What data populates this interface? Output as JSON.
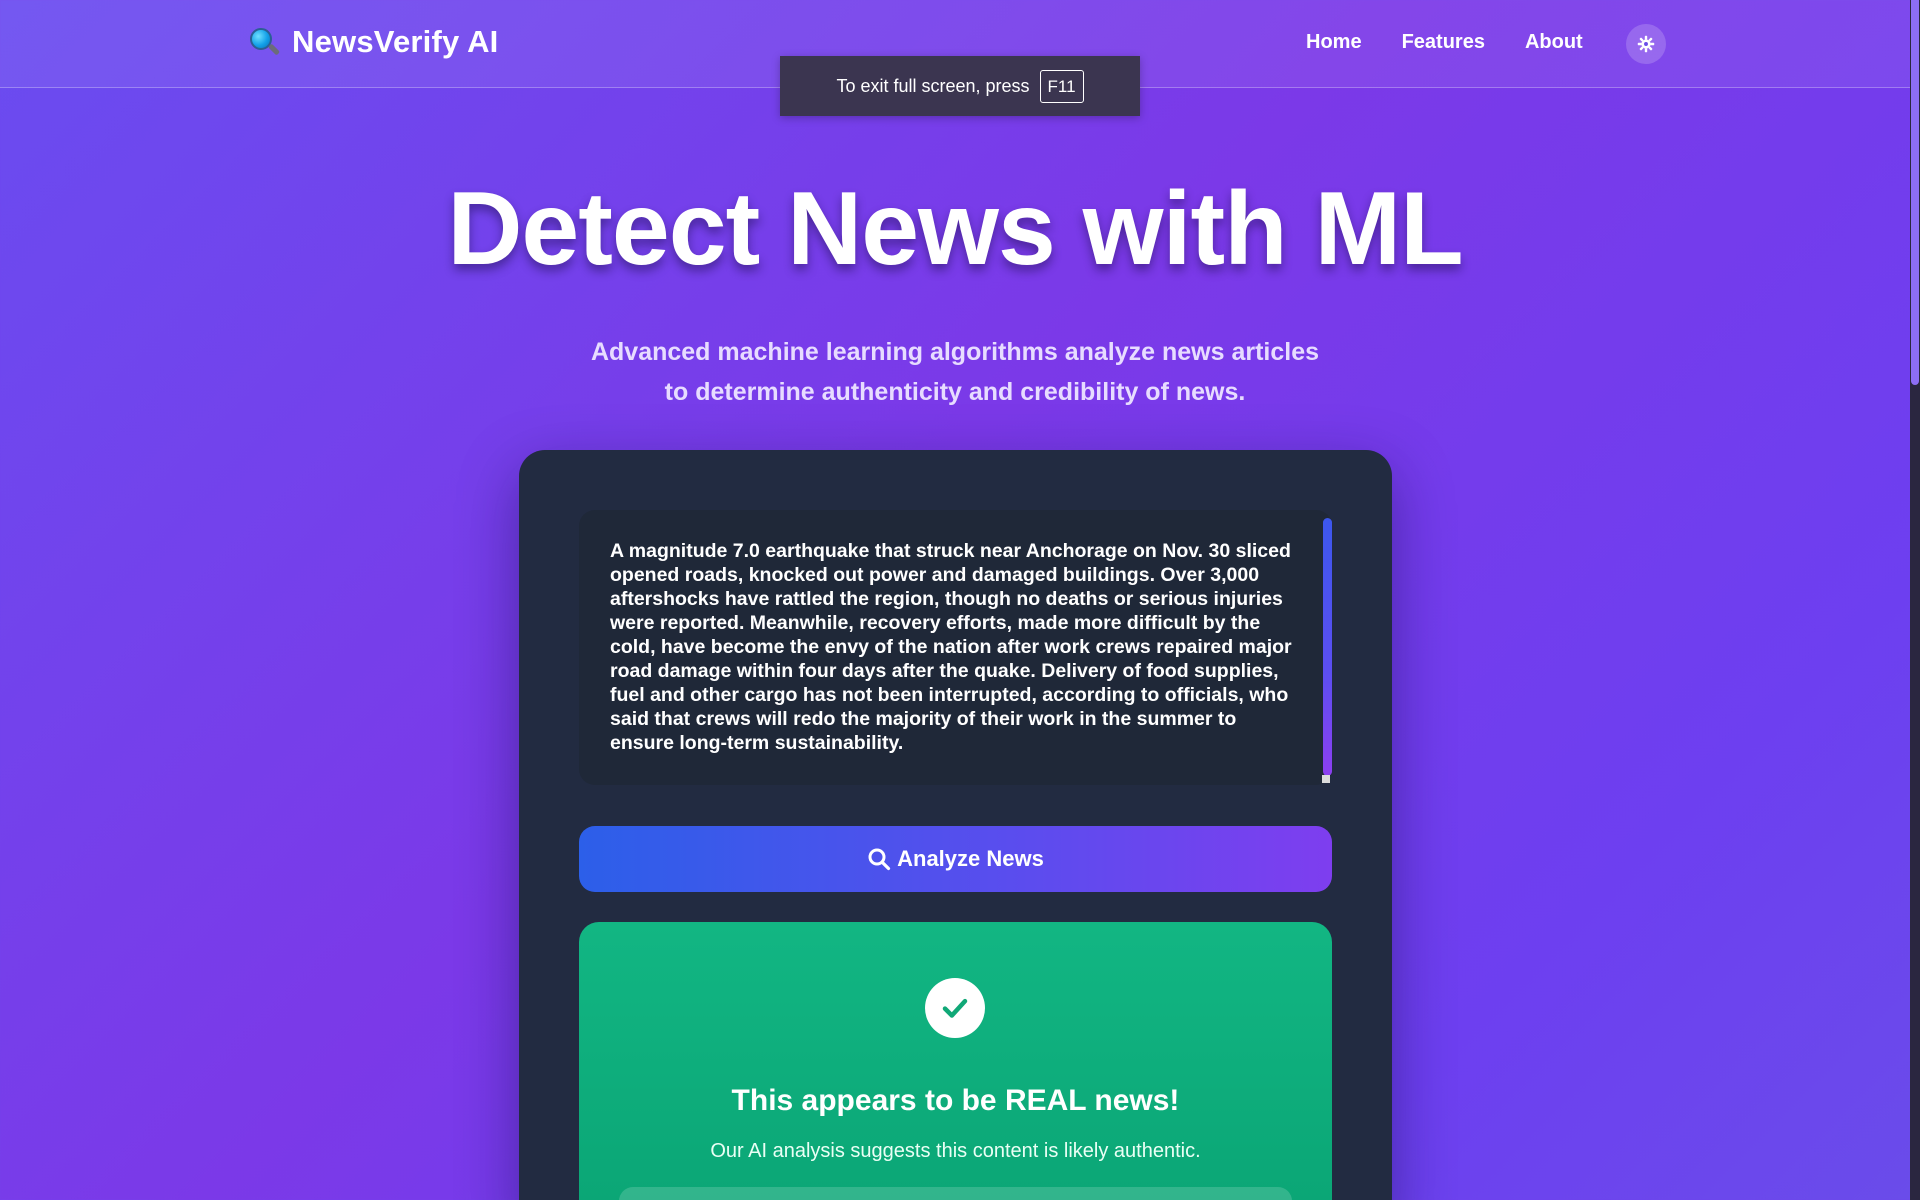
{
  "navbar": {
    "brand_icon": "magnifier-icon",
    "brand_name": "NewsVerify AI",
    "links": [
      "Home",
      "Features",
      "About"
    ],
    "theme_toggle_icon": "gear-icon"
  },
  "fullscreen_toast": {
    "text": "To exit full screen, press",
    "key": "F11"
  },
  "hero": {
    "title": "Detect News with ML",
    "subtitle_line1": "Advanced machine learning algorithms analyze news articles",
    "subtitle_line2": "to determine authenticity and credibility of news."
  },
  "analyzer": {
    "article_text": "A magnitude 7.0 earthquake that struck near Anchorage on Nov. 30 sliced opened roads, knocked out power and damaged buildings. Over 3,000 aftershocks have rattled the region, though no deaths or serious injuries were reported. Meanwhile, recovery efforts, made more difficult by the cold, have become the envy of the nation after work crews repaired major road damage within four days after the quake. Delivery of food supplies, fuel and other cargo has not been interrupted, according to officials, who said that crews will redo the majority of their work in the summer to ensure long-term sustainability.",
    "analyze_button_icon": "search-icon",
    "analyze_button_label": "Analyze News"
  },
  "result": {
    "icon": "check-icon",
    "title": "This appears to be REAL news!",
    "description": "Our AI analysis suggests this content is likely authentic.",
    "color": "#10b07f"
  },
  "colors": {
    "background_start": "#6a4cf0",
    "background_end": "#7b39e8",
    "card": "#222b41",
    "button_start": "#2c5fe9",
    "button_end": "#7e3eef",
    "success": "#10b07f"
  }
}
